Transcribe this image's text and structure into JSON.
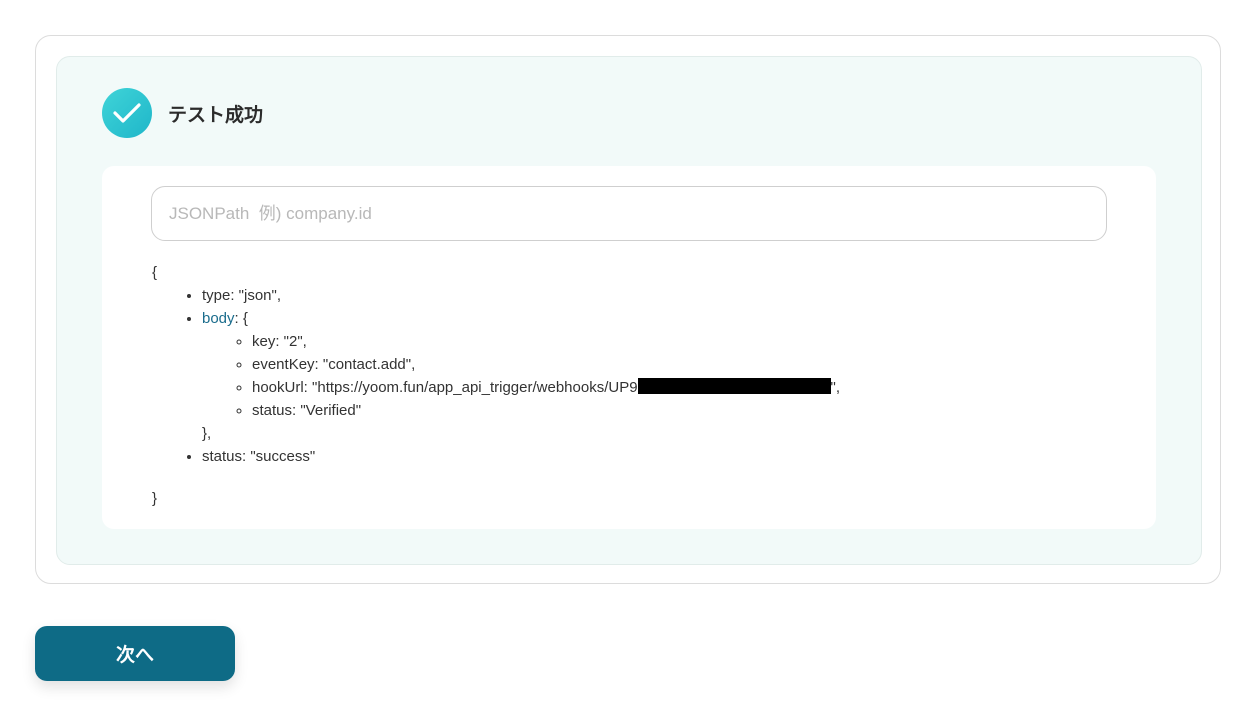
{
  "status": {
    "title": "テスト成功",
    "icon": "check-icon"
  },
  "search": {
    "placeholder": "JSONPath  例) company.id",
    "value": ""
  },
  "json": {
    "open_brace": "{",
    "close_brace": "}",
    "items": {
      "type": "type: \"json\",",
      "body_key": "body",
      "body_open": ": {",
      "body_close": "},",
      "key": "key: \"2\",",
      "eventKey": "eventKey: \"contact.add\",",
      "hookUrl_prefix": "hookUrl: \"https://yoom.fun/app_api_trigger/webhooks/UP9",
      "hookUrl_suffix": "\",",
      "status_inner": "status: \"Verified\"",
      "status_outer": "status: \"success\""
    }
  },
  "actions": {
    "next_label": "次へ"
  },
  "colors": {
    "accent": "#0e6b86",
    "panel_bg": "#f2faf9",
    "check_gradient_start": "#3fd4d8",
    "check_gradient_end": "#1fb6c9",
    "link": "#1a6c8c"
  }
}
